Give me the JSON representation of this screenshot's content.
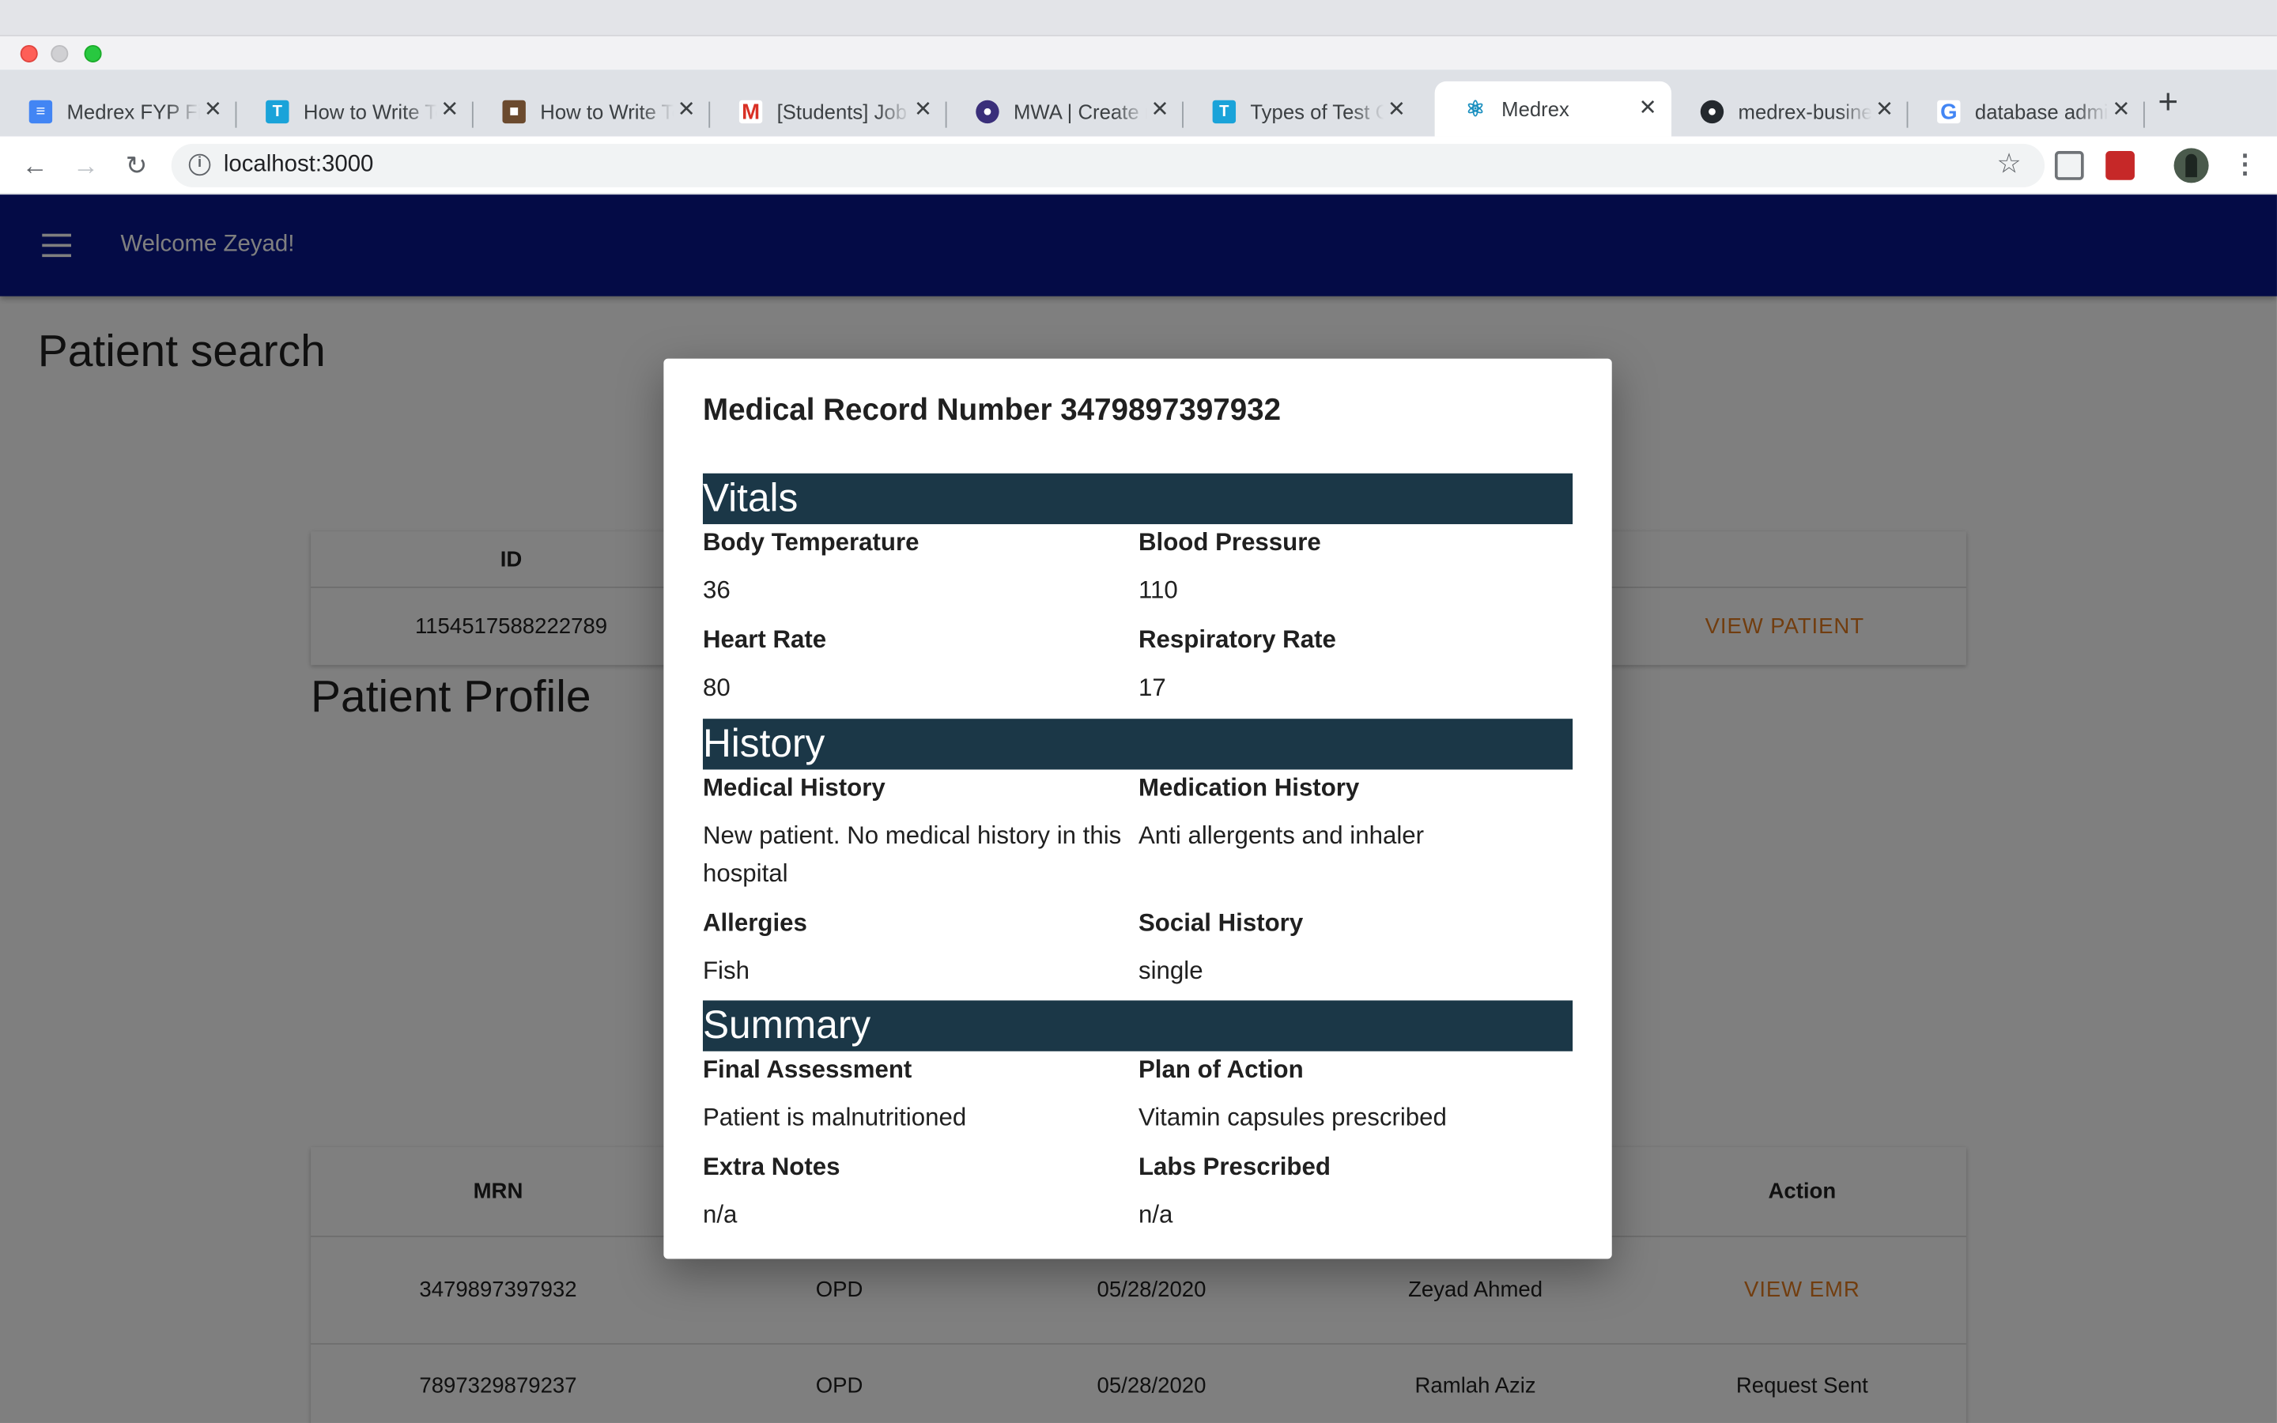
{
  "browser": {
    "tabs": [
      {
        "title": "Medrex FYP Final Report",
        "icon": "google-docs-icon",
        "color": "#4285f4",
        "active": false
      },
      {
        "title": "How to Write Test Cases",
        "icon": "guru99-icon",
        "color": "#1aa3d9",
        "active": false
      },
      {
        "title": "How to Write Test Cases",
        "icon": "cube-icon",
        "color": "#6b4a2e",
        "active": false
      },
      {
        "title": "[Students] Job Openings",
        "icon": "gmail-icon",
        "color": "#d93025",
        "active": false
      },
      {
        "title": "MWA | Create new",
        "icon": "mwa-icon",
        "color": "#3a2f7a",
        "active": false
      },
      {
        "title": "Types of Test Cases",
        "icon": "guru99-icon",
        "color": "#1aa3d9",
        "active": false
      },
      {
        "title": "Medrex",
        "icon": "react-icon",
        "color": "#1a8fbf",
        "active": true
      },
      {
        "title": "medrex-business",
        "icon": "github-icon",
        "color": "#24292e",
        "active": false
      },
      {
        "title": "database administration",
        "icon": "google-icon",
        "color": "#4285f4",
        "active": false
      }
    ],
    "url": "localhost:3000"
  },
  "app": {
    "welcome": "Welcome Zeyad!",
    "patient_search_title": "Patient search",
    "search_table": {
      "header_id": "ID",
      "row_id": "1154517588222789",
      "action": "VIEW PATIENT"
    },
    "patient_profile_title": "Patient Profile",
    "records_table": {
      "headers": {
        "mrn": "MRN",
        "action": "Action"
      },
      "rows": [
        {
          "mrn": "3479897397932",
          "type": "OPD",
          "date": "05/28/2020",
          "doctor": "Zeyad Ahmed",
          "action": "VIEW EMR"
        },
        {
          "mrn": "7897329879237",
          "type": "OPD",
          "date": "05/28/2020",
          "doctor": "Ramlah Aziz",
          "action": "Request Sent"
        }
      ]
    }
  },
  "dialog": {
    "title": "Medical Record Number 3479897397932",
    "vitals": {
      "heading": "Vitals",
      "body_temperature_label": "Body Temperature",
      "body_temperature": "36",
      "blood_pressure_label": "Blood Pressure",
      "blood_pressure": "110",
      "heart_rate_label": "Heart Rate",
      "heart_rate": "80",
      "respiratory_rate_label": "Respiratory Rate",
      "respiratory_rate": "17"
    },
    "history": {
      "heading": "History",
      "medical_history_label": "Medical History",
      "medical_history": "New patient. No medical history in this hospital",
      "medication_history_label": "Medication History",
      "medication_history": "Anti allergents and inhaler",
      "allergies_label": "Allergies",
      "allergies": "Fish",
      "social_history_label": "Social History",
      "social_history": "single"
    },
    "summary": {
      "heading": "Summary",
      "final_assessment_label": "Final Assessment",
      "final_assessment": "Patient is malnutritioned",
      "plan_of_action_label": "Plan of Action",
      "plan_of_action": "Vitamin capsules prescribed",
      "extra_notes_label": "Extra Notes",
      "extra_notes": "n/a",
      "labs_prescribed_label": "Labs Prescribed",
      "labs_prescribed": "n/a"
    }
  },
  "colors": {
    "appbar": "#08168d",
    "section_header": "#1b3747",
    "link_orange": "#e37b1f"
  }
}
